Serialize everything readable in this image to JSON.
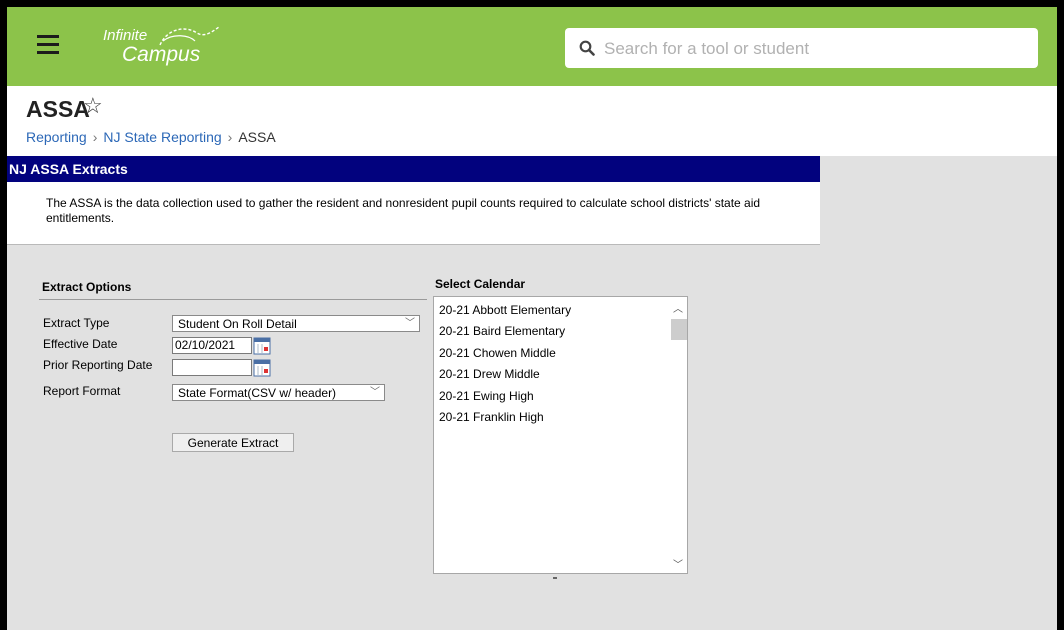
{
  "app": {
    "logo_line1": "Infinite",
    "logo_line2": "Campus",
    "search_placeholder": "Search for a tool or student",
    "menu_icon": "hamburger-menu-icon",
    "search_icon": "search-icon",
    "brand_color": "#8cc34a"
  },
  "page": {
    "title": "ASSA",
    "favorite_icon": "star-outline-icon",
    "breadcrumb": [
      "Reporting",
      "NJ State Reporting",
      "ASSA"
    ]
  },
  "panel": {
    "header": "NJ ASSA Extracts",
    "header_color": "#02027e",
    "description": "The ASSA is the data collection used to gather the resident and nonresident pupil counts required to calculate school districts' state aid entitlements."
  },
  "extract_options": {
    "title": "Extract Options",
    "extract_type_label": "Extract Type",
    "extract_type_value": "Student On Roll Detail",
    "effective_date_label": "Effective Date",
    "effective_date_value": "02/10/2021",
    "prior_date_label": "Prior Reporting Date",
    "prior_date_value": "",
    "report_format_label": "Report Format",
    "report_format_value": "State Format(CSV w/ header)",
    "generate_button": "Generate Extract"
  },
  "calendar": {
    "title": "Select Calendar",
    "items": [
      "20-21 Abbott Elementary",
      "20-21 Baird Elementary",
      "20-21 Chowen Middle",
      "20-21 Drew Middle",
      "20-21 Ewing High",
      "20-21 Franklin High"
    ]
  }
}
